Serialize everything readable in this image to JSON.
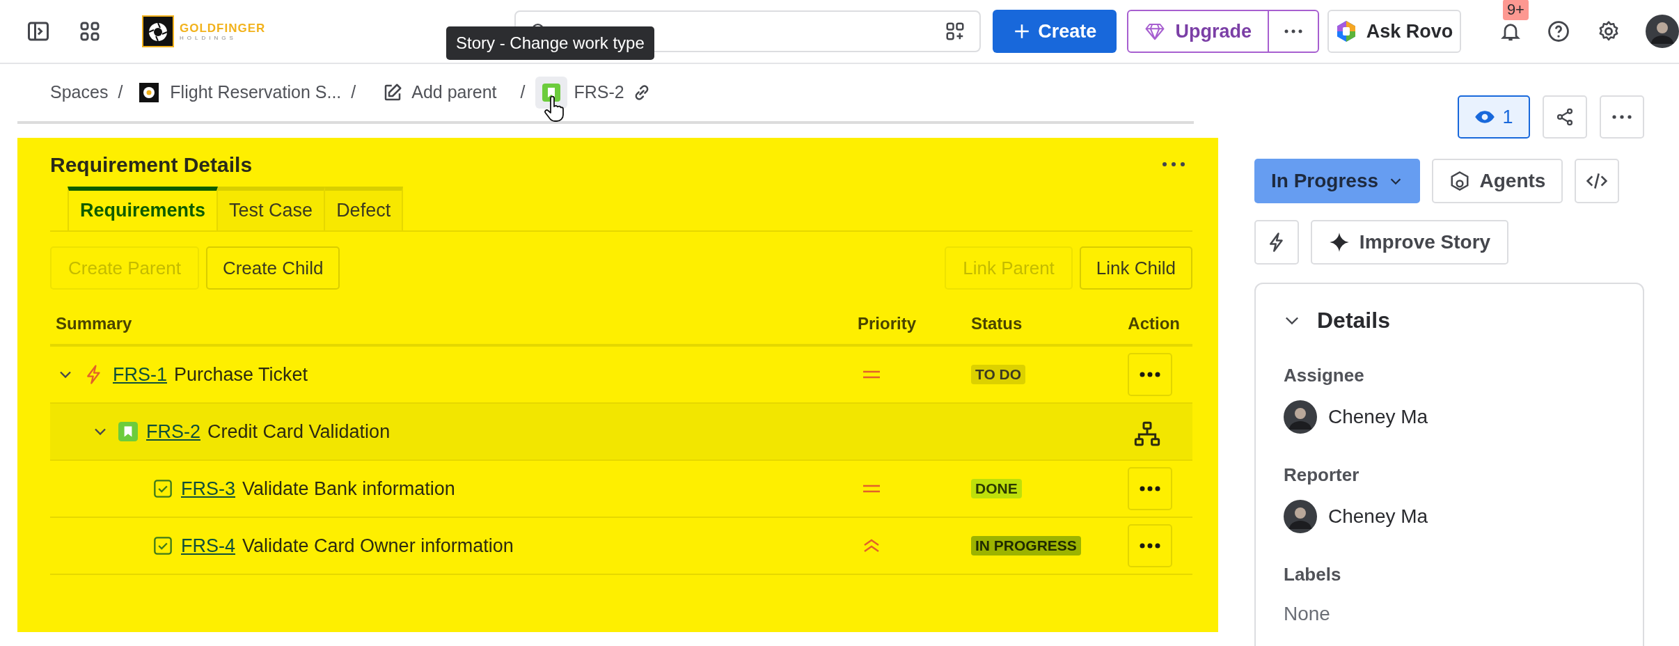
{
  "topbar": {
    "brand": {
      "name": "GOLDFINGER",
      "tagline": "HOLDINGS"
    },
    "create": "Create",
    "upgrade": "Upgrade",
    "ask": "Ask Rovo",
    "notifications": "9+"
  },
  "tooltip": "Story - Change work type",
  "breadcrumbs": [
    {
      "kind": "link",
      "label": "Spaces"
    },
    {
      "kind": "space",
      "separator": "/",
      "label": "Flight Reservation S..."
    },
    {
      "kind": "add",
      "separator": "/",
      "label": "Add parent"
    },
    {
      "kind": "issue",
      "separator": "/",
      "label": "FRS-2"
    }
  ],
  "watchers": "1",
  "panel": {
    "title": "Requirement Details",
    "tabs": [
      {
        "label": "Requirements",
        "selected": true
      },
      {
        "label": "Test Case",
        "selected": false
      },
      {
        "label": "Defect",
        "selected": false
      }
    ],
    "left_buttons": [
      {
        "label": "Create Parent",
        "disabled": true
      },
      {
        "label": "Create Child",
        "disabled": false
      }
    ],
    "right_buttons": [
      {
        "label": "Link Parent",
        "disabled": true
      },
      {
        "label": "Link Child",
        "disabled": false
      }
    ],
    "columns": [
      "Summary",
      "Priority",
      "Status",
      "Action"
    ],
    "rows": [
      {
        "key": "FRS-1",
        "title": "Purchase Ticket",
        "kind": "epic",
        "expanded": true,
        "selected": false,
        "priority": {
          "kind": "medium"
        },
        "status": {
          "label": "TO DO",
          "kind": "todo"
        },
        "children": [
          {
            "key": "FRS-2",
            "title": "Credit Card Validation",
            "kind": "story",
            "expanded": true,
            "selected": true,
            "children": [
              {
                "key": "FRS-3",
                "title": "Validate Bank information",
                "kind": "task",
                "selected": false,
                "priority": {
                  "kind": "medium"
                },
                "status": {
                  "label": "DONE",
                  "kind": "done"
                }
              },
              {
                "key": "FRS-4",
                "title": "Validate Card Owner information",
                "kind": "task",
                "selected": false,
                "priority": {
                  "kind": "high"
                },
                "status": {
                  "label": "IN PROGRESS",
                  "kind": "progress"
                }
              }
            ]
          }
        ]
      }
    ]
  },
  "sidebar": {
    "status": "In Progress",
    "agents": "Agents",
    "improve": "Improve Story",
    "details": {
      "title": "Details",
      "expanded": true,
      "fields": [
        {
          "label": "Assignee",
          "kind": "user",
          "value": "Cheney Ma"
        },
        {
          "label": "Reporter",
          "kind": "user",
          "value": "Cheney Ma"
        },
        {
          "label": "Labels",
          "kind": "text",
          "value": "None"
        }
      ]
    }
  }
}
